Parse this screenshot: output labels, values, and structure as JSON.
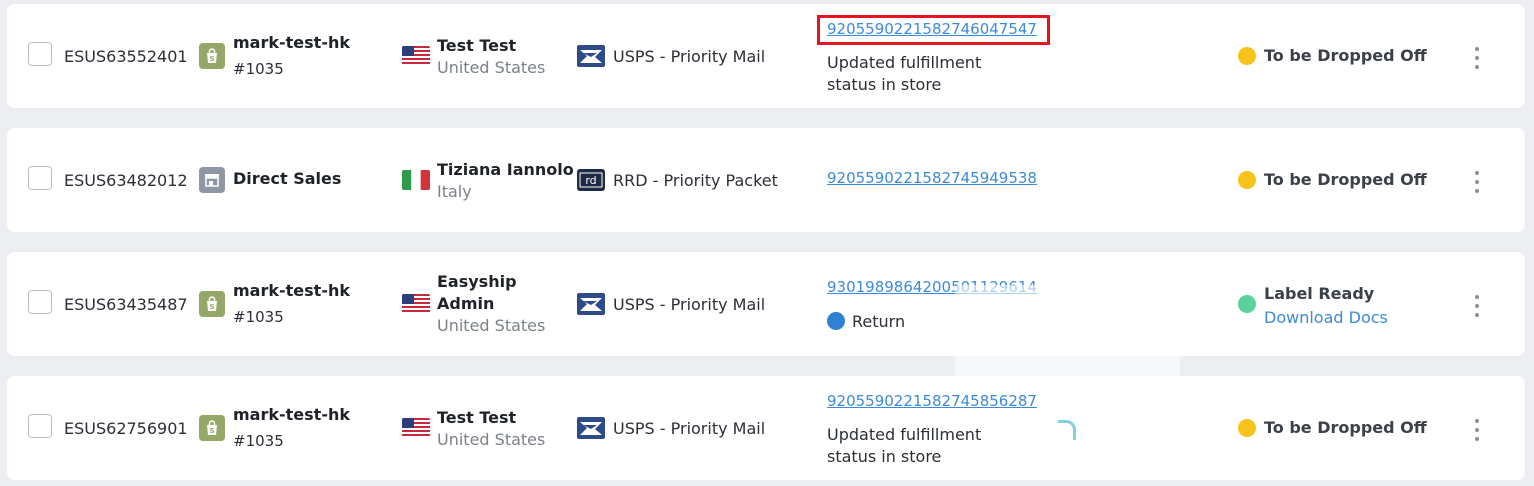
{
  "rows": [
    {
      "shipment_id": "ESUS63552401",
      "store": "mark-test-hk",
      "order": "#1035",
      "recipient_lines": [
        "Test Test"
      ],
      "country": "United States",
      "courier": "USPS - Priority Mail",
      "tracking": "9205590221582746047547",
      "note_lines": [
        "Updated fulfillment",
        "status in store"
      ],
      "status": "To be Dropped Off"
    },
    {
      "shipment_id": "ESUS63482012",
      "store": "Direct Sales",
      "recipient_lines": [
        "Tiziana Iannolo"
      ],
      "country": "Italy",
      "courier": "RRD - Priority Packet",
      "tracking": "9205590221582745949538",
      "status": "To be Dropped Off"
    },
    {
      "shipment_id": "ESUS63435487",
      "store": "mark-test-hk",
      "order": "#1035",
      "recipient_lines": [
        "Easyship",
        "Admin"
      ],
      "country": "United States",
      "courier": "USPS - Priority Mail",
      "tracking": "9301989864200501129614",
      "return_label": "Return",
      "status": "Label Ready",
      "download_label": "Download Docs"
    },
    {
      "shipment_id": "ESUS62756901",
      "store": "mark-test-hk",
      "order": "#1035",
      "recipient_lines": [
        "Test Test"
      ],
      "country": "United States",
      "courier": "USPS - Priority Mail",
      "tracking": "9205590221582745856287",
      "note_lines": [
        "Updated fulfillment",
        "status in store"
      ],
      "status": "To be Dropped Off"
    }
  ],
  "colors": {
    "status_yellow": "#f6c31a",
    "status_green": "#5bd19c",
    "link_blue": "#3c8ad8",
    "highlight_red": "#e5151f"
  },
  "icons": {
    "store_shopify": "shopify-bag-icon",
    "store_direct": "storefront-icon",
    "flag_us": "us-flag-icon",
    "flag_it": "italy-flag-icon",
    "courier_usps": "usps-eagle-icon",
    "courier_rrd": "rrd-logo-icon",
    "more": "kebab-menu-icon"
  }
}
